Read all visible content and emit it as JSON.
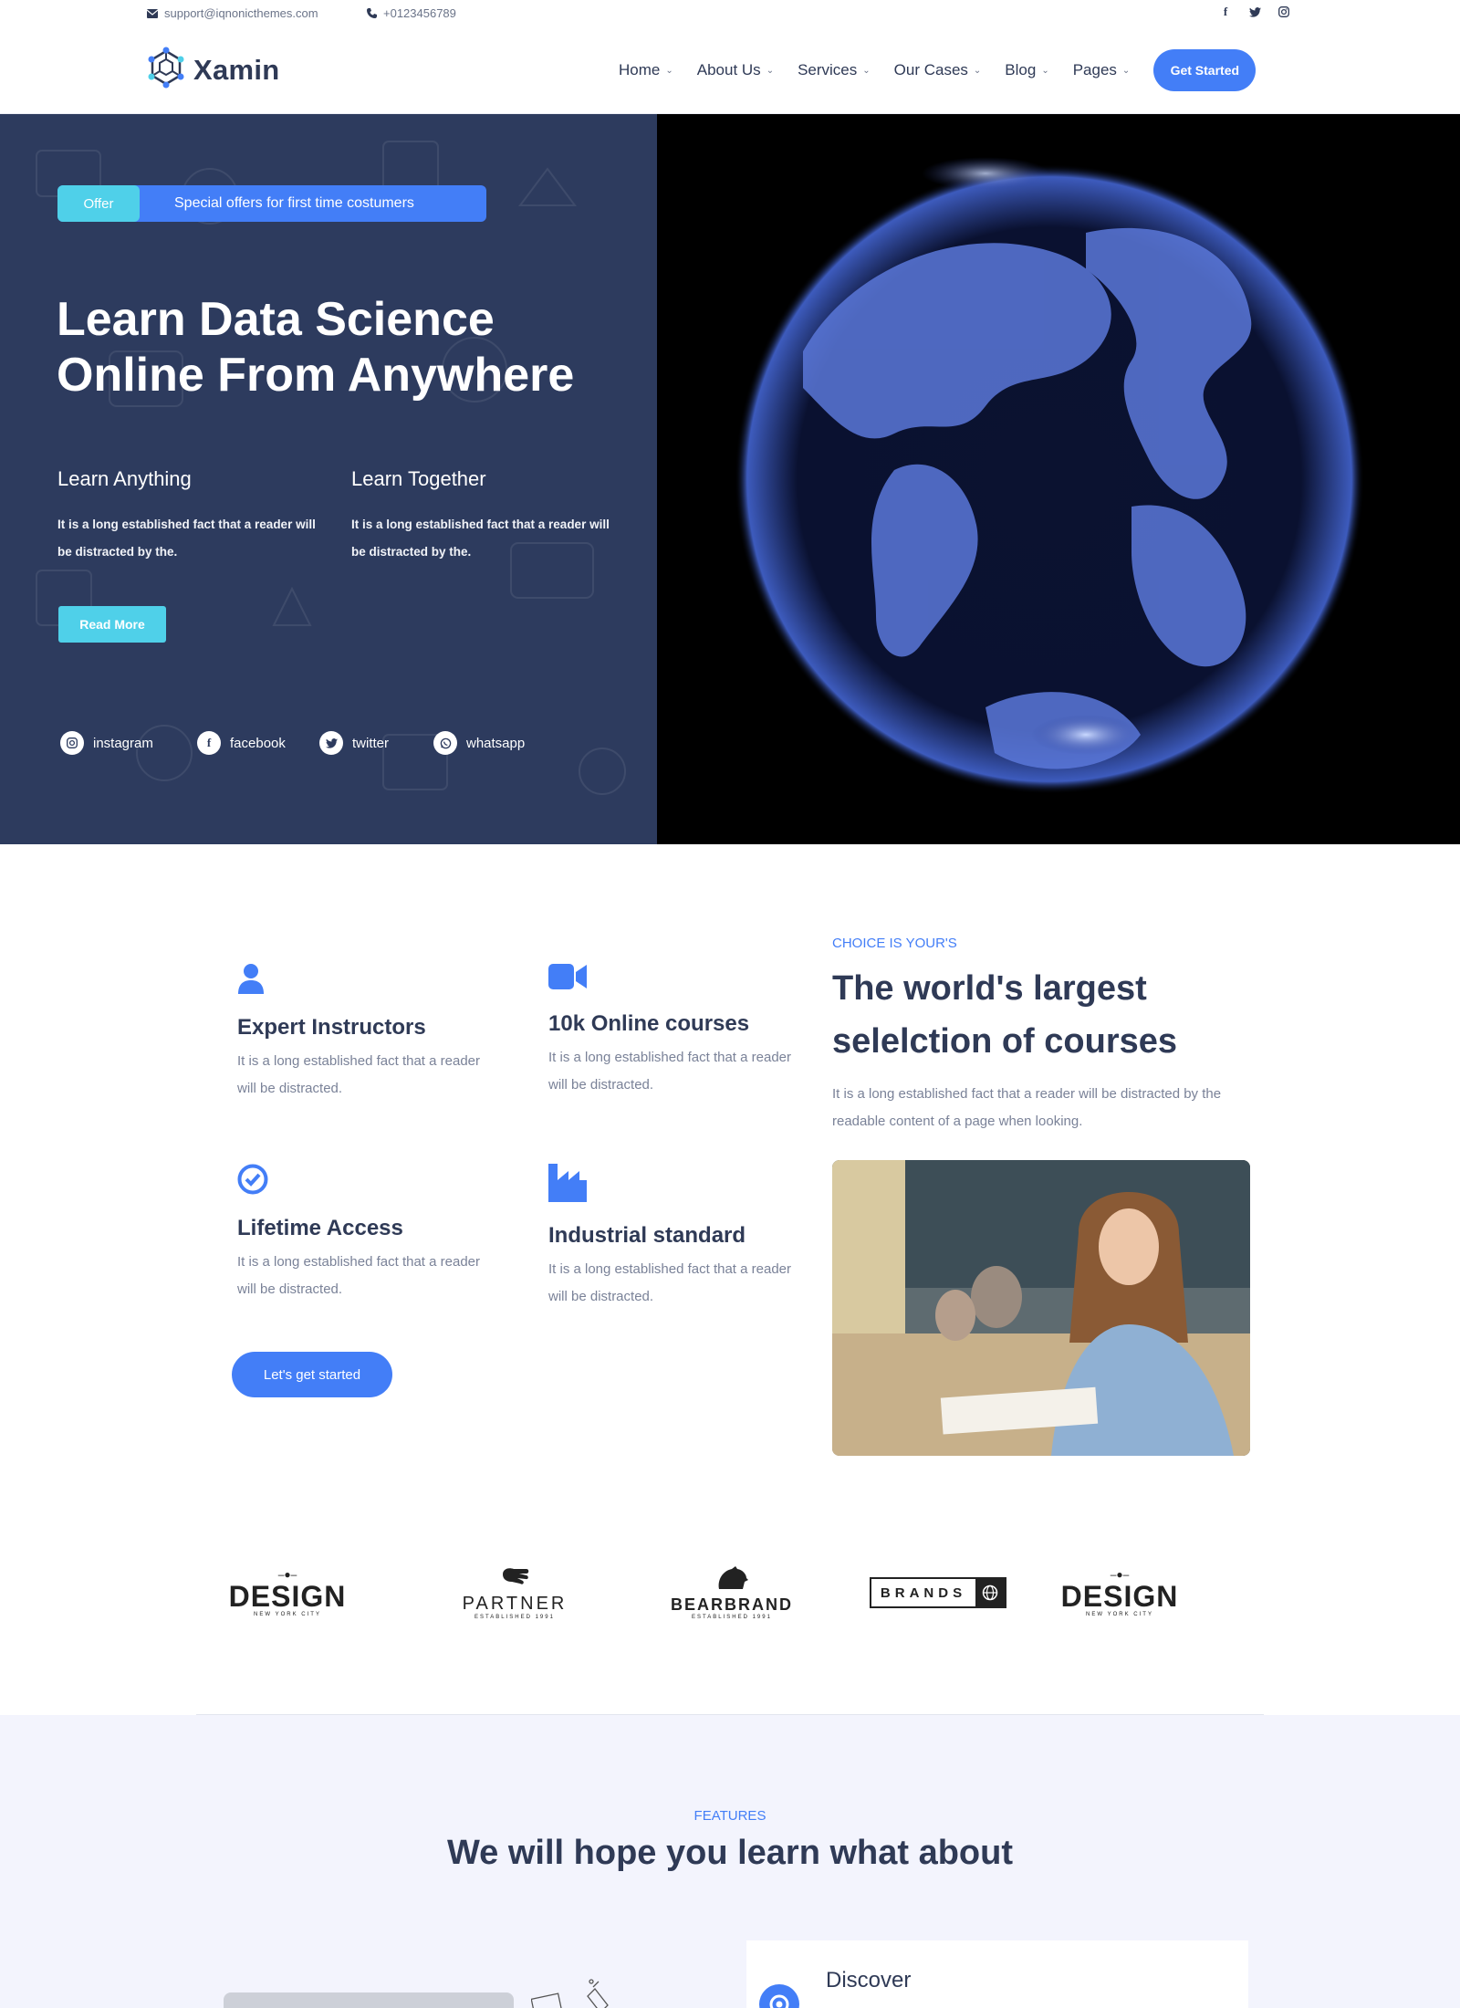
{
  "topbar": {
    "email": "support@iqnonicthemes.com",
    "phone": "+0123456789",
    "socials": [
      "facebook-icon",
      "twitter-icon",
      "instagram-icon"
    ]
  },
  "header": {
    "logo_text": "Xamin",
    "nav": [
      {
        "label": "Home"
      },
      {
        "label": "About Us"
      },
      {
        "label": "Services"
      },
      {
        "label": "Our Cases"
      },
      {
        "label": "Blog"
      },
      {
        "label": "Pages"
      }
    ],
    "cta_label": "Get Started"
  },
  "hero": {
    "offer_tag": "Offer",
    "offer_text": "Special offers for first time costumers",
    "title_line1": "Learn Data Science",
    "title_line2": "Online From Anywhere",
    "columns": [
      {
        "title": "Learn Anything",
        "text": "It is a long established fact that a reader will be distracted by the."
      },
      {
        "title": "Learn Together",
        "text": "It is a long established fact that a reader will be distracted by the."
      }
    ],
    "read_more": "Read More",
    "socials": [
      {
        "label": "instagram",
        "icon": "instagram-icon"
      },
      {
        "label": "facebook",
        "icon": "facebook-icon"
      },
      {
        "label": "twitter",
        "icon": "twitter-icon"
      },
      {
        "label": "whatsapp",
        "icon": "whatsapp-icon"
      }
    ]
  },
  "features": [
    {
      "title": "Expert Instructors",
      "text": "It is a long established fact that a reader will be distracted.",
      "icon": "user-icon"
    },
    {
      "title": "10k Online courses",
      "text": "It is a long established fact that a reader will be distracted.",
      "icon": "video-camera-icon"
    },
    {
      "title": "Lifetime Access",
      "text": "It is a long established fact that a reader will be distracted.",
      "icon": "check-circle-icon"
    },
    {
      "title": "Industrial standard",
      "text": "It is a long established fact that a reader will be distracted.",
      "icon": "industry-icon"
    }
  ],
  "lets_started": "Let's get started",
  "choice": {
    "eyebrow": "CHOICE IS YOUR'S",
    "title": "The world's largest selelction of courses",
    "text": "It is a long established fact that a reader will be distracted by the readable content of a page when looking."
  },
  "brands": [
    {
      "name": "DESIGN",
      "sub": "NEW YORK CITY"
    },
    {
      "name": "PARTNER",
      "sub": "ESTABLISHED 1991"
    },
    {
      "name": "BEARBRAND",
      "sub": "ESTABLISHED 1991"
    },
    {
      "name": "BRANDS",
      "sub": ""
    },
    {
      "name": "DESIGN",
      "sub": "NEW YORK CITY"
    }
  ],
  "features_section": {
    "eyebrow": "FEATURES",
    "title": "We will hope you learn what about",
    "card_title": "Discover"
  },
  "colors": {
    "primary": "#437ef7",
    "accent": "#4fd0e9",
    "dark": "#2d3b5e",
    "heading": "#2f3a56"
  }
}
